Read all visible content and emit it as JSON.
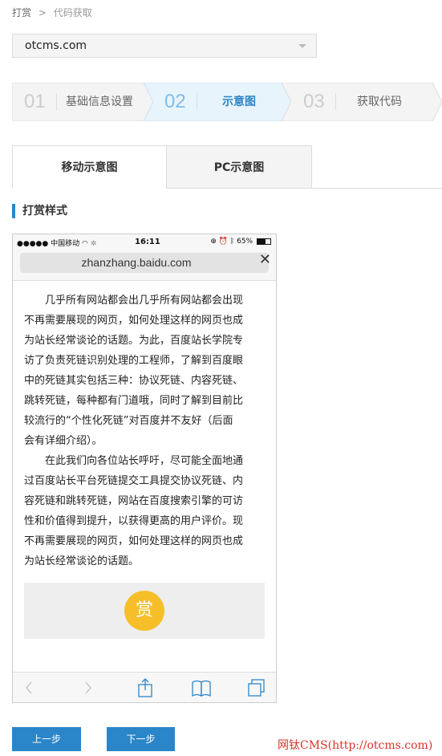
{
  "breadcrumb": {
    "root": "打赏",
    "separator": ">",
    "current": "代码获取"
  },
  "site_select": {
    "value": "otcms.com"
  },
  "steps": [
    {
      "num": "01",
      "label": "基础信息设置"
    },
    {
      "num": "02",
      "label": "示意图"
    },
    {
      "num": "03",
      "label": "获取代码"
    }
  ],
  "tabs": [
    {
      "label": "移动示意图"
    },
    {
      "label": "PC示意图"
    }
  ],
  "section_title": "打赏样式",
  "phone": {
    "status": {
      "carrier": "●●●●● 中国移动",
      "time": "16:11",
      "battery": "65%",
      "battery_level": 0.65
    },
    "url": "zhanzhang.baidu.com",
    "close": "✕",
    "paragraph1_lines": [
      "几乎所有网站都会出几乎所有网站都会出现",
      "不再需要展现的网页，如何处理这样的网页也成",
      "为站长经常谈论的话题。为此，百度站长学院专",
      "访了负责死链识别处理的工程师，了解到百度眼",
      "中的死链其实包括三种：协议死链、内容死链、",
      "跳转死链，每种都有门道哦，同时了解到目前比",
      "较流行的“个性化死链”对百度并不友好（后面",
      "会有详细介绍）。"
    ],
    "paragraph2_lines": [
      "在此我们向各位站长呼吁，尽可能全面地通",
      "过百度站长平台死链提交工具提交协议死链、内",
      "容死链和跳转死链，网站在百度搜索引擎的可访",
      "性和价值得到提升，以获得更高的用户评价。现",
      "不再需要展现的网页，如何处理这样的网页也成",
      "为站长经常谈论的话题。"
    ],
    "reward_label": "赏"
  },
  "buttons": {
    "prev": "上一步",
    "next": "下一步"
  },
  "watermark": "网钛CMS(http://otcms.com)",
  "colors": {
    "accent": "#2b86c9",
    "step_active_bg": "#e8f4fc",
    "reward": "#f6bf2a",
    "watermark": "#d9342b"
  }
}
